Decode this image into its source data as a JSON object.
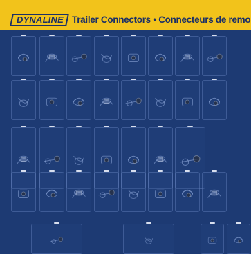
{
  "header": {
    "brand": "DYNALINE",
    "title": "Trailer Connectors • Connecteurs de remorque"
  },
  "colors": {
    "background": "#1d3a73",
    "header_bar": "#f2c31b",
    "header_text": "#1b2f66"
  },
  "rows": [
    {
      "name": "row-1",
      "cards": 8
    },
    {
      "name": "row-2",
      "cards": 8
    },
    {
      "name": "row-3",
      "cards": 7
    },
    {
      "name": "row-4",
      "cards": 8
    },
    {
      "name": "row-5",
      "cards": 4
    }
  ]
}
